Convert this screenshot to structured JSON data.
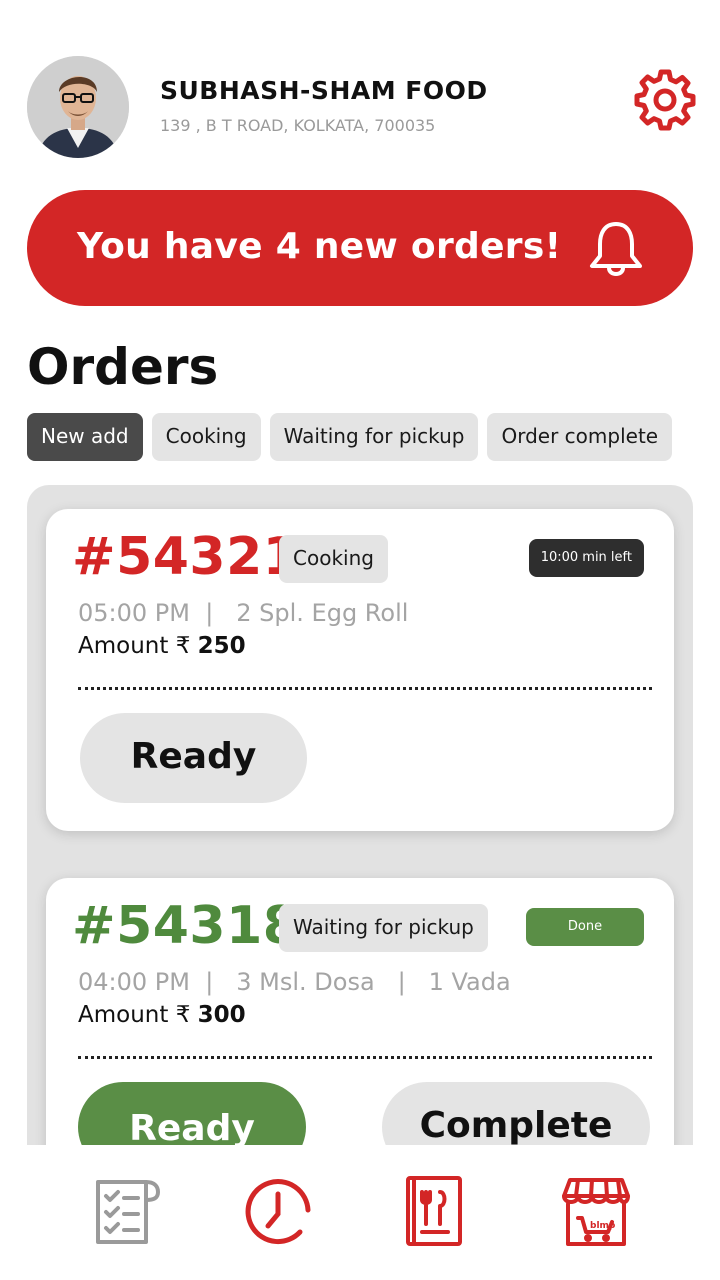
{
  "header": {
    "store_name": "SUBHASH-SHAM FOOD",
    "address": "139 , B T ROAD, KOLKATA, 700035",
    "avatar_icon": "user-avatar",
    "settings_icon": "gear-icon"
  },
  "banner": {
    "text": "You have 4 new orders!",
    "icon": "bell-icon",
    "color": "#d32626"
  },
  "orders_title": "Orders",
  "tabs": [
    {
      "label": "New add",
      "active": true
    },
    {
      "label": "Cooking",
      "active": false
    },
    {
      "label": "Waiting for pickup",
      "active": false
    },
    {
      "label": "Order complete",
      "active": false
    }
  ],
  "orders": [
    {
      "id": "#54321",
      "id_color": "#d32626",
      "status": "Cooking",
      "time_left": "10:00 min left",
      "time": "05:00 PM",
      "items": "2 Spl. Egg Roll",
      "amount_label": "Amount",
      "currency": "₹",
      "amount": "250",
      "ready_label": "Ready"
    },
    {
      "id": "#54318",
      "id_color": "#4f8a3d",
      "status": "Waiting for pickup",
      "done_label": "Done",
      "time": "04:00 PM",
      "items": "3 Msl. Dosa",
      "items2": "1 Vada",
      "amount_label": "Amount",
      "currency": "₹",
      "amount": "300",
      "ready_label": "Ready",
      "complete_label": "Complete"
    }
  ],
  "bottom_nav": [
    {
      "icon": "checklist-icon",
      "color": "#9a9a9a"
    },
    {
      "icon": "clock-icon",
      "color": "#d32626"
    },
    {
      "icon": "menu-book-icon",
      "color": "#d32626"
    },
    {
      "icon": "store-icon",
      "color": "#d32626"
    }
  ]
}
